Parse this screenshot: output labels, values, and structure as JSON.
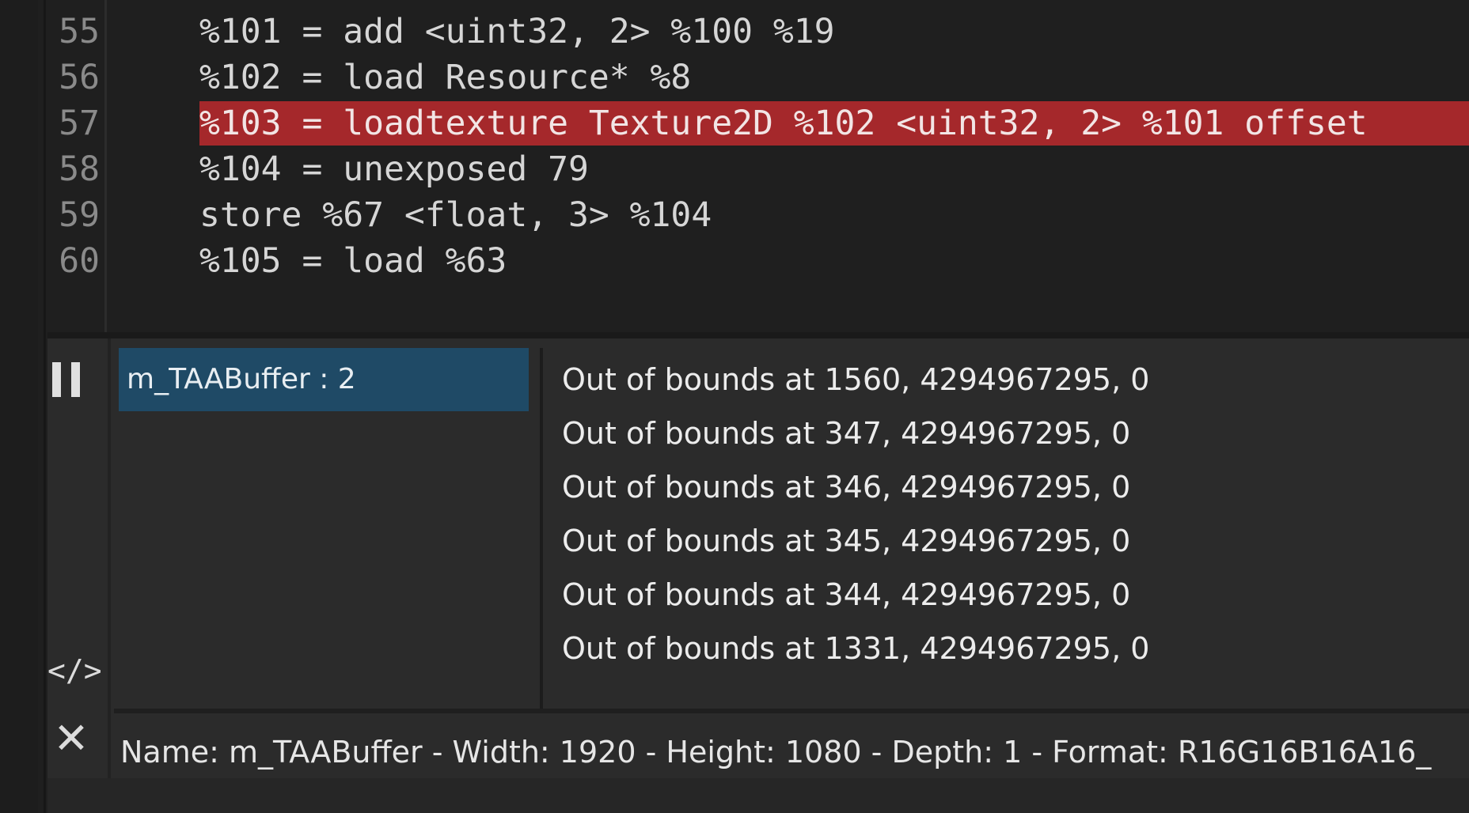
{
  "editor": {
    "lines": [
      {
        "number": "55",
        "code": "%101 = add <uint32, 2> %100 %19",
        "highlighted": false
      },
      {
        "number": "56",
        "code": "%102 = load Resource* %8",
        "highlighted": false
      },
      {
        "number": "57",
        "code": "%103 = loadtexture Texture2D %102 <uint32, 2> %101 offset",
        "highlighted": true
      },
      {
        "number": "58",
        "code": "%104 = unexposed 79",
        "highlighted": false
      },
      {
        "number": "59",
        "code": "store %67 <float, 3> %104",
        "highlighted": false
      },
      {
        "number": "60",
        "code": "%105 = load %63",
        "highlighted": false
      }
    ]
  },
  "panel": {
    "resources": [
      {
        "label": "m_TAABuffer : 2",
        "selected": true
      }
    ],
    "messages": [
      "Out of bounds at 1560, 4294967295, 0",
      "Out of bounds at 347, 4294967295, 0",
      "Out of bounds at 346, 4294967295, 0",
      "Out of bounds at 345, 4294967295, 0",
      "Out of bounds at 344, 4294967295, 0",
      "Out of bounds at 1331, 4294967295, 0"
    ],
    "status": "Name: m_TAABuffer - Width: 1920 - Height: 1080 - Depth: 1 - Format: R16G16B16A16_",
    "icons": {
      "pause": "pause-icon",
      "code": "code-icon",
      "close": "close-icon",
      "code_glyph": "</>",
      "close_glyph": "✕"
    }
  },
  "colors": {
    "editor_bg": "#1f1f1f",
    "highlight": "#a5282b",
    "selection": "#1f4a66",
    "panel_bg": "#2b2b2b"
  }
}
